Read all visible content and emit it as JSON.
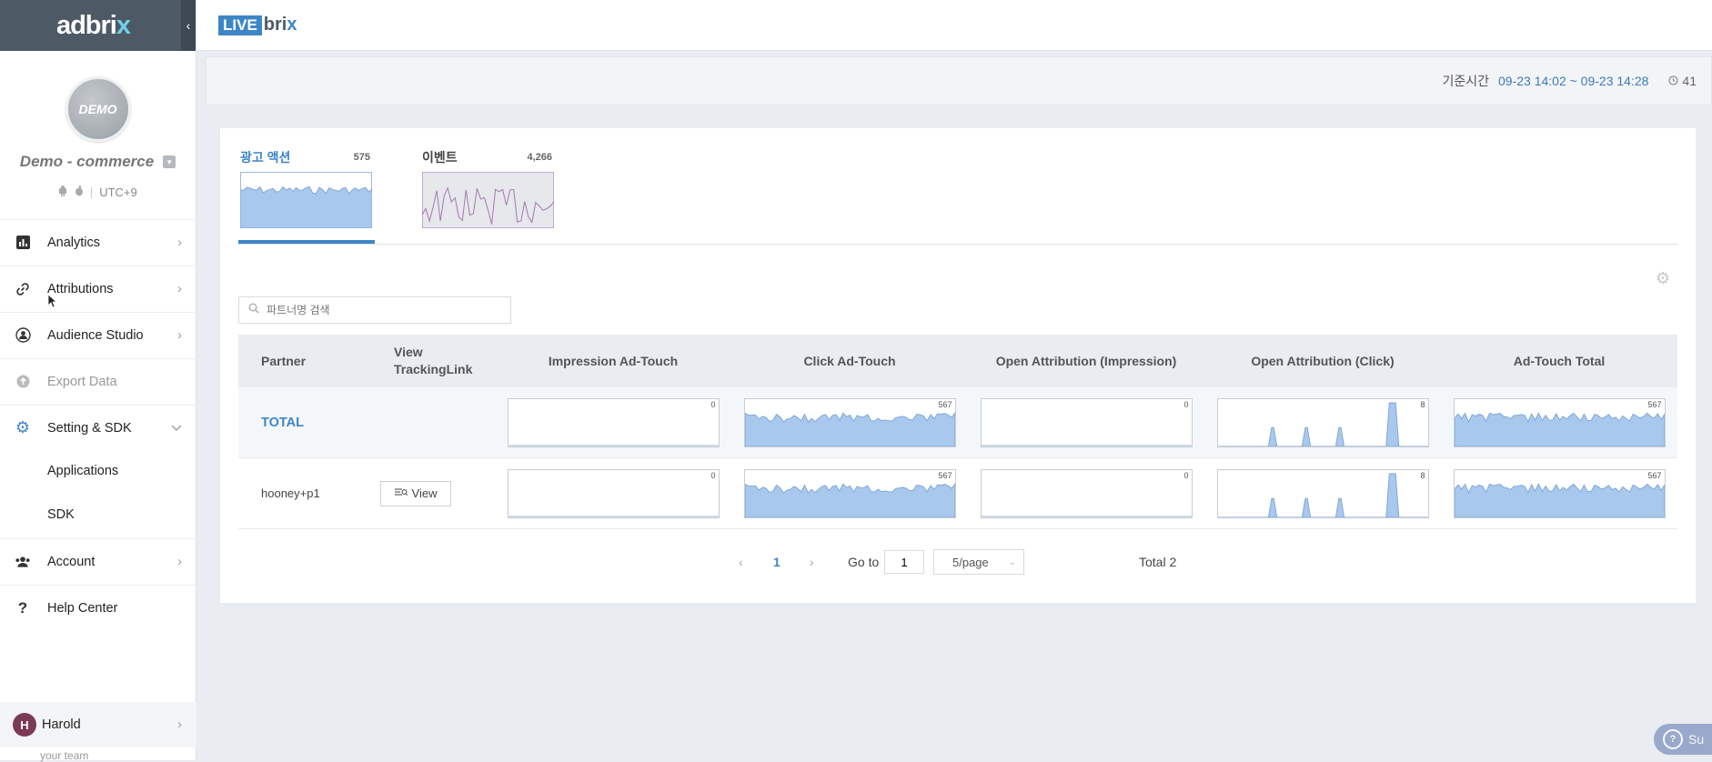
{
  "sidebar": {
    "brand": {
      "text": "adbri",
      "x": "x"
    },
    "collapse_icon": "chevron-left",
    "profile": {
      "avatar_text": "DEMO",
      "account_name": "Demo - commerce",
      "timezone": "UTC+9",
      "platform_icons": [
        "android-icon",
        "apple-icon"
      ]
    },
    "menu": [
      {
        "label": "Analytics",
        "icon": "bar-chart-icon",
        "chevron": "›"
      },
      {
        "label": "Attributions",
        "icon": "link-icon",
        "chevron": "›"
      },
      {
        "label": "Audience Studio",
        "icon": "audience-icon",
        "chevron": "›"
      },
      {
        "label": "Export Data",
        "icon": "upload-icon",
        "disabled": true
      },
      {
        "label": "Setting & SDK",
        "icon": "gear-icon",
        "chevron": "⌄",
        "active": true
      },
      {
        "label": "Account",
        "icon": "users-icon",
        "chevron": "›"
      },
      {
        "label": "Help Center",
        "icon": "question-icon"
      }
    ],
    "submenu": [
      {
        "label": "Applications"
      },
      {
        "label": "SDK"
      }
    ],
    "user": {
      "initial": "H",
      "name": "Harold"
    },
    "team_label": "your team"
  },
  "topbar": {
    "logo_live": "LIVE",
    "logo_bri": "bri",
    "logo_x": "x"
  },
  "infobar": {
    "time_label": "기준시간",
    "time_range": "09-23 14:02 ~ 09-23 14:28",
    "refresh_count": "41"
  },
  "summary_tabs": [
    {
      "label": "광고 액션",
      "count": "575",
      "active": true,
      "color": "#3d86c6"
    },
    {
      "label": "이벤트",
      "count": "4,266",
      "active": false,
      "color": "#a678b0"
    }
  ],
  "search": {
    "placeholder": "파트너명 검색"
  },
  "table": {
    "headers": {
      "partner": "Partner",
      "view_tracking": "View TrackingLink",
      "impression": "Impression Ad-Touch",
      "click": "Click Ad-Touch",
      "open_impression": "Open Attribution (Impression)",
      "open_click": "Open Attribution (Click)",
      "total": "Ad-Touch Total"
    },
    "rows": [
      {
        "partner": "TOTAL",
        "view_label": "",
        "impression_max": "0",
        "click_max": "567",
        "open_impression_max": "0",
        "open_click_max": "8",
        "total_max": "567"
      },
      {
        "partner": "hooney+p1",
        "view_label": "View",
        "impression_max": "0",
        "click_max": "567",
        "open_impression_max": "0",
        "open_click_max": "8",
        "total_max": "567"
      }
    ]
  },
  "pagination": {
    "prev": "‹",
    "current_page": "1",
    "next": "›",
    "goto_label": "Go to",
    "goto_value": "1",
    "page_size": "5/page",
    "total": "Total 2"
  },
  "support": {
    "label": "Su"
  },
  "colors": {
    "accent": "#3d86c6",
    "sidebar_brand_bg": "#4d5a66",
    "chart_fill": "#a9c8ee"
  }
}
